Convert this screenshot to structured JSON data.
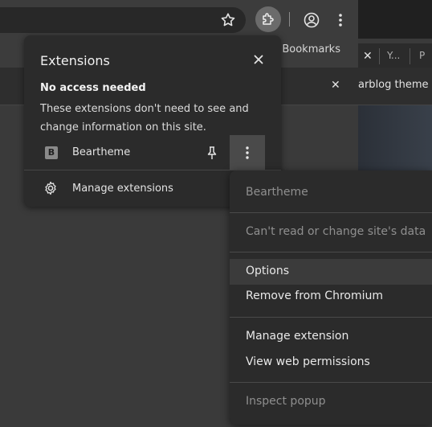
{
  "bookmarks": {
    "all_bookmarks_label": "ll Bookmarks"
  },
  "tabs": {
    "partial_tab_1": "Y...",
    "partial_tab_2": "P"
  },
  "infobar": {
    "text": "arblog theme r"
  },
  "popup": {
    "title": "Extensions",
    "section_heading": "No access needed",
    "section_description": "These extensions don't need to see and change information on this site.",
    "extension": {
      "icon_letter": "B",
      "name": "Beartheme"
    },
    "manage_label": "Manage extensions"
  },
  "context_menu": {
    "header": "Beartheme",
    "site_access": "Can't read or change site's data",
    "options": "Options",
    "remove": "Remove from Chromium",
    "manage": "Manage extension",
    "permissions": "View web permissions",
    "inspect": "Inspect popup"
  },
  "colors": {
    "surface": "#2b2b2b",
    "hover": "#3b3b3b",
    "disabled_text": "#8f8f8f",
    "text": "#e8e8e8"
  },
  "icons": {
    "star": "star-icon",
    "extensions": "puzzle-icon",
    "profile": "profile-icon",
    "menu": "kebab-icon",
    "pin": "pin-icon",
    "settings": "gear-icon",
    "close": "close-icon"
  }
}
